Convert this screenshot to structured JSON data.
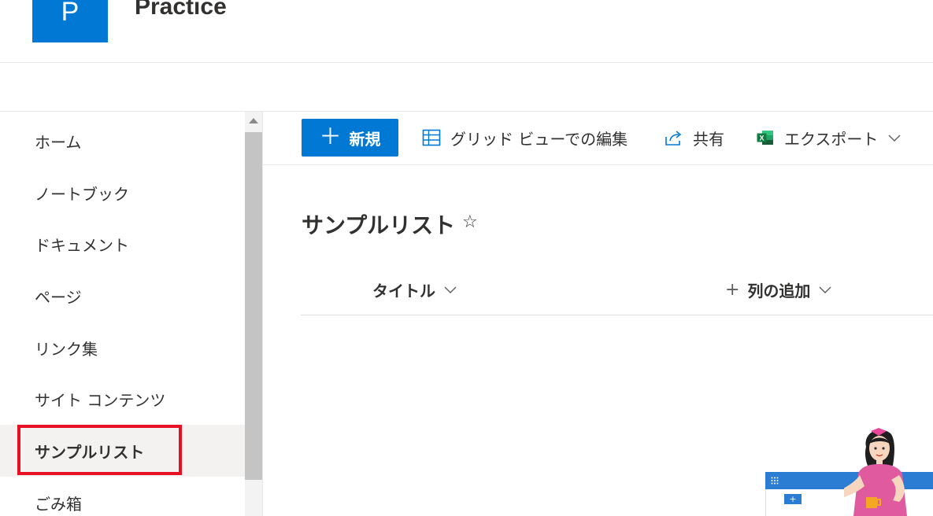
{
  "site": {
    "logo_letter": "P",
    "title": "Practice"
  },
  "nav": {
    "items": [
      {
        "label": "ホーム"
      },
      {
        "label": "ノートブック"
      },
      {
        "label": "ドキュメント"
      },
      {
        "label": "ページ"
      },
      {
        "label": "リンク集"
      },
      {
        "label": "サイト コンテンツ"
      },
      {
        "label": "サンプルリスト",
        "active": true
      },
      {
        "label": "ごみ箱"
      }
    ]
  },
  "commands": {
    "new": "新規",
    "grid_edit": "グリッド ビューでの編集",
    "share": "共有",
    "export": "エクスポート"
  },
  "list": {
    "title": "サンプルリスト",
    "columns": {
      "title": "タイトル",
      "add": "列の追加"
    }
  },
  "colors": {
    "brand": "#0078d4",
    "highlight": "#e81123",
    "excel": "#107c41"
  },
  "icons": {
    "new": "plus-icon",
    "grid_edit": "grid-icon",
    "share": "share-icon",
    "export": "excel-icon",
    "favorite": "star-icon"
  }
}
